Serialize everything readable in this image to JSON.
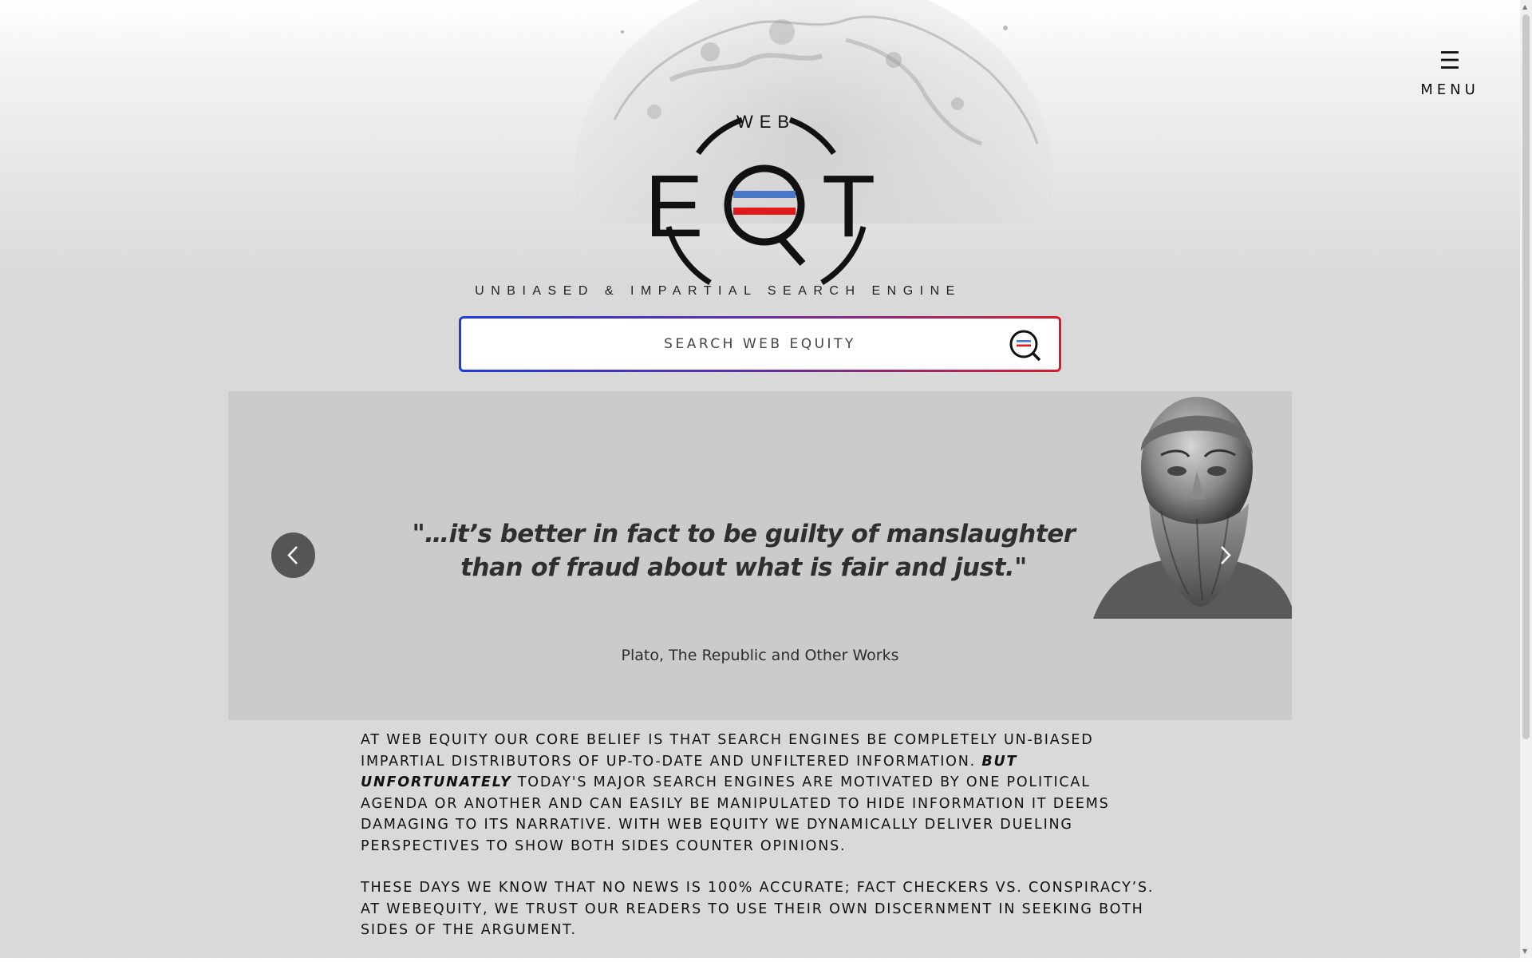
{
  "header": {
    "menu_label": "MENU",
    "menu_icon": "hamburger-icon"
  },
  "logo": {
    "top_word": "WEB",
    "letters": [
      "E",
      "Q",
      "T"
    ],
    "tagline": "UNBIASED & IMPARTIAL SEARCH ENGINE",
    "colors": {
      "blue": "#4a78c8",
      "red": "#e01a1a",
      "black": "#111111"
    }
  },
  "search": {
    "placeholder": "SEARCH WEB EQUITY",
    "icon": "search-equity-icon",
    "border_gradient": [
      "#1f3bdc",
      "#d81c2c"
    ]
  },
  "carousel": {
    "quote": "\"…it’s better in fact to be guilty of manslaughter than of fraud about what is fair and just.\"",
    "attribution": "Plato, The Republic and Other Works",
    "prev_icon": "chevron-left-icon",
    "next_icon": "chevron-right-icon",
    "image": "plato-bust"
  },
  "about": {
    "p1_before": "AT WEB EQUITY OUR CORE BELIEF IS THAT SEARCH ENGINES BE COMPLETELY UN-BIASED IMPARTIAL DISTRIBUTORS OF UP-TO-DATE AND UNFILTERED INFORMATION. ",
    "p1_emphasis": "BUT UNFORTUNATELY",
    "p1_after": " TODAY'S MAJOR SEARCH ENGINES ARE MOTIVATED BY ONE POLITICAL AGENDA OR ANOTHER AND CAN EASILY BE MANIPULATED TO HIDE INFORMATION IT DEEMS DAMAGING TO ITS NARRATIVE. WITH WEB EQUITY WE DYNAMICALLY DELIVER DUELING PERSPECTIVES TO SHOW BOTH SIDES COUNTER OPINIONS.",
    "p2": "THESE DAYS WE KNOW THAT NO NEWS IS 100% ACCURATE; FACT CHECKERS VS. CONSPIRACY’S. AT WEBEQUITY, WE TRUST OUR READERS TO USE THEIR OWN DISCERNMENT IN SEEKING BOTH SIDES OF THE ARGUMENT."
  }
}
